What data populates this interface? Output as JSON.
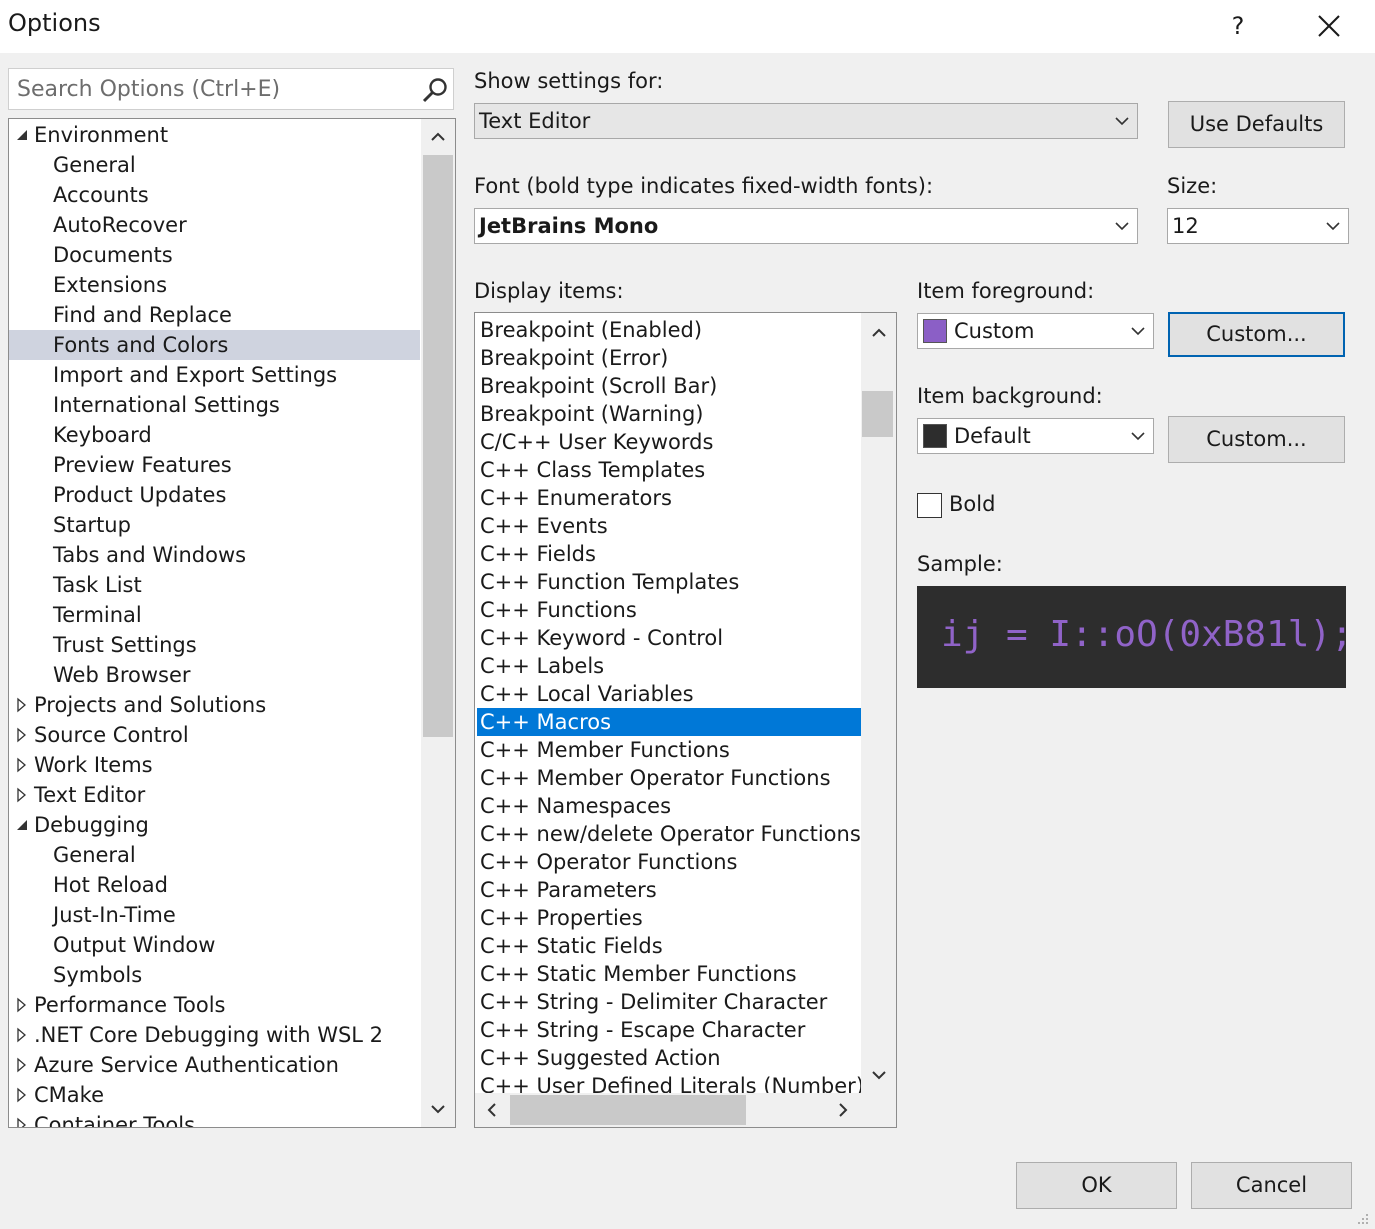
{
  "window": {
    "title": "Options",
    "help_label": "?",
    "close_label": "×"
  },
  "search": {
    "placeholder": "Search Options (Ctrl+E)"
  },
  "tree": {
    "items": [
      {
        "label": "Environment",
        "level": 0,
        "state": "expanded"
      },
      {
        "label": "General",
        "level": 1
      },
      {
        "label": "Accounts",
        "level": 1
      },
      {
        "label": "AutoRecover",
        "level": 1
      },
      {
        "label": "Documents",
        "level": 1
      },
      {
        "label": "Extensions",
        "level": 1
      },
      {
        "label": "Find and Replace",
        "level": 1
      },
      {
        "label": "Fonts and Colors",
        "level": 1,
        "selected": true
      },
      {
        "label": "Import and Export Settings",
        "level": 1
      },
      {
        "label": "International Settings",
        "level": 1
      },
      {
        "label": "Keyboard",
        "level": 1
      },
      {
        "label": "Preview Features",
        "level": 1
      },
      {
        "label": "Product Updates",
        "level": 1
      },
      {
        "label": "Startup",
        "level": 1
      },
      {
        "label": "Tabs and Windows",
        "level": 1
      },
      {
        "label": "Task List",
        "level": 1
      },
      {
        "label": "Terminal",
        "level": 1
      },
      {
        "label": "Trust Settings",
        "level": 1
      },
      {
        "label": "Web Browser",
        "level": 1
      },
      {
        "label": "Projects and Solutions",
        "level": 0,
        "state": "collapsed"
      },
      {
        "label": "Source Control",
        "level": 0,
        "state": "collapsed"
      },
      {
        "label": "Work Items",
        "level": 0,
        "state": "collapsed"
      },
      {
        "label": "Text Editor",
        "level": 0,
        "state": "collapsed"
      },
      {
        "label": "Debugging",
        "level": 0,
        "state": "expanded"
      },
      {
        "label": "General",
        "level": 1
      },
      {
        "label": "Hot Reload",
        "level": 1
      },
      {
        "label": "Just-In-Time",
        "level": 1
      },
      {
        "label": "Output Window",
        "level": 1
      },
      {
        "label": "Symbols",
        "level": 1
      },
      {
        "label": "Performance Tools",
        "level": 0,
        "state": "collapsed"
      },
      {
        "label": ".NET Core Debugging with WSL 2",
        "level": 0,
        "state": "collapsed"
      },
      {
        "label": "Azure Service Authentication",
        "level": 0,
        "state": "collapsed"
      },
      {
        "label": "CMake",
        "level": 0,
        "state": "collapsed"
      },
      {
        "label": "Container Tools",
        "level": 0,
        "state": "collapsed"
      }
    ]
  },
  "settings": {
    "show_settings_for_label": "Show settings for:",
    "show_settings_for_value": "Text Editor",
    "use_defaults_label": "Use Defaults",
    "font_label": "Font (bold type indicates fixed-width fonts):",
    "font_value": "JetBrains Mono",
    "size_label": "Size:",
    "size_value": "12",
    "display_items_label": "Display items:",
    "item_foreground_label": "Item foreground:",
    "item_foreground_value": "Custom",
    "item_foreground_color": "#8b5fc6",
    "item_background_label": "Item background:",
    "item_background_value": "Default",
    "item_background_color": "#2d2d2d",
    "custom_button_label": "Custom...",
    "bold_label": "Bold",
    "bold_checked": false,
    "sample_label": "Sample:",
    "sample_text": "ij = I::oO(0xB81l);"
  },
  "display_items": [
    "Breakpoint (Enabled)",
    "Breakpoint (Error)",
    "Breakpoint (Scroll Bar)",
    "Breakpoint (Warning)",
    "C/C++ User Keywords",
    "C++ Class Templates",
    "C++ Enumerators",
    "C++ Events",
    "C++ Fields",
    "C++ Function Templates",
    "C++ Functions",
    "C++ Keyword - Control",
    "C++ Labels",
    "C++ Local Variables",
    "C++ Macros",
    "C++ Member Functions",
    "C++ Member Operator Functions",
    "C++ Namespaces",
    "C++ new/delete Operator Functions",
    "C++ Operator Functions",
    "C++ Parameters",
    "C++ Properties",
    "C++ Static Fields",
    "C++ Static Member Functions",
    "C++ String - Delimiter Character",
    "C++ String - Escape Character",
    "C++ Suggested Action",
    "C++ User Defined Literals (Number)"
  ],
  "display_items_selected": "C++ Macros",
  "footer": {
    "ok_label": "OK",
    "cancel_label": "Cancel"
  },
  "colors": {
    "selection": "#0078d7",
    "tree_selection": "#cfd3df",
    "focus_border": "#0063b1"
  }
}
